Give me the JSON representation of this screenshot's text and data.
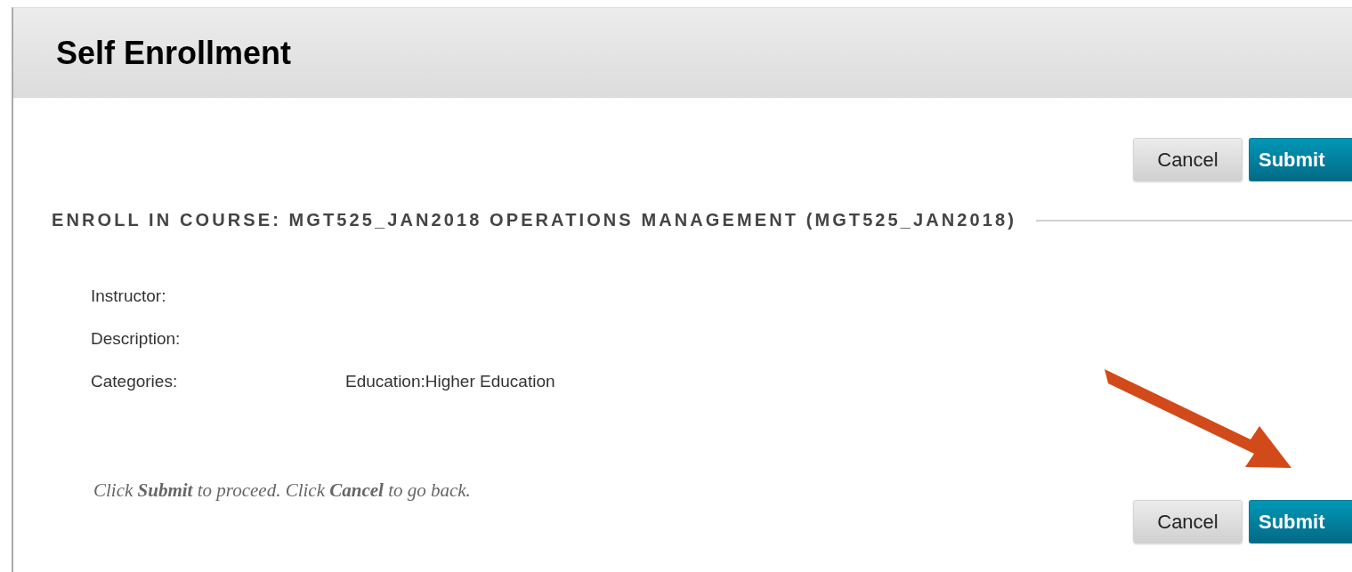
{
  "title": "Self Enrollment",
  "top_buttons": [
    {
      "label": "Cancel",
      "kind": "secondary"
    },
    {
      "label": "Submit",
      "kind": "primary"
    }
  ],
  "section_heading": "ENROLL IN COURSE: MGT525_JAN2018 OPERATIONS MANAGEMENT (MGT525_JAN2018)",
  "fields": [
    {
      "label": "Instructor:"
    },
    {
      "label": "Description:"
    },
    {
      "label": "Categories:",
      "value": "Education:Higher Education"
    }
  ],
  "instruction": "Click **Submit** to proceed. Click **Cancel** to go back.",
  "bottom_buttons": [
    {
      "label": "Cancel",
      "kind": "secondary"
    },
    {
      "label": "Submit",
      "kind": "primary"
    }
  ]
}
